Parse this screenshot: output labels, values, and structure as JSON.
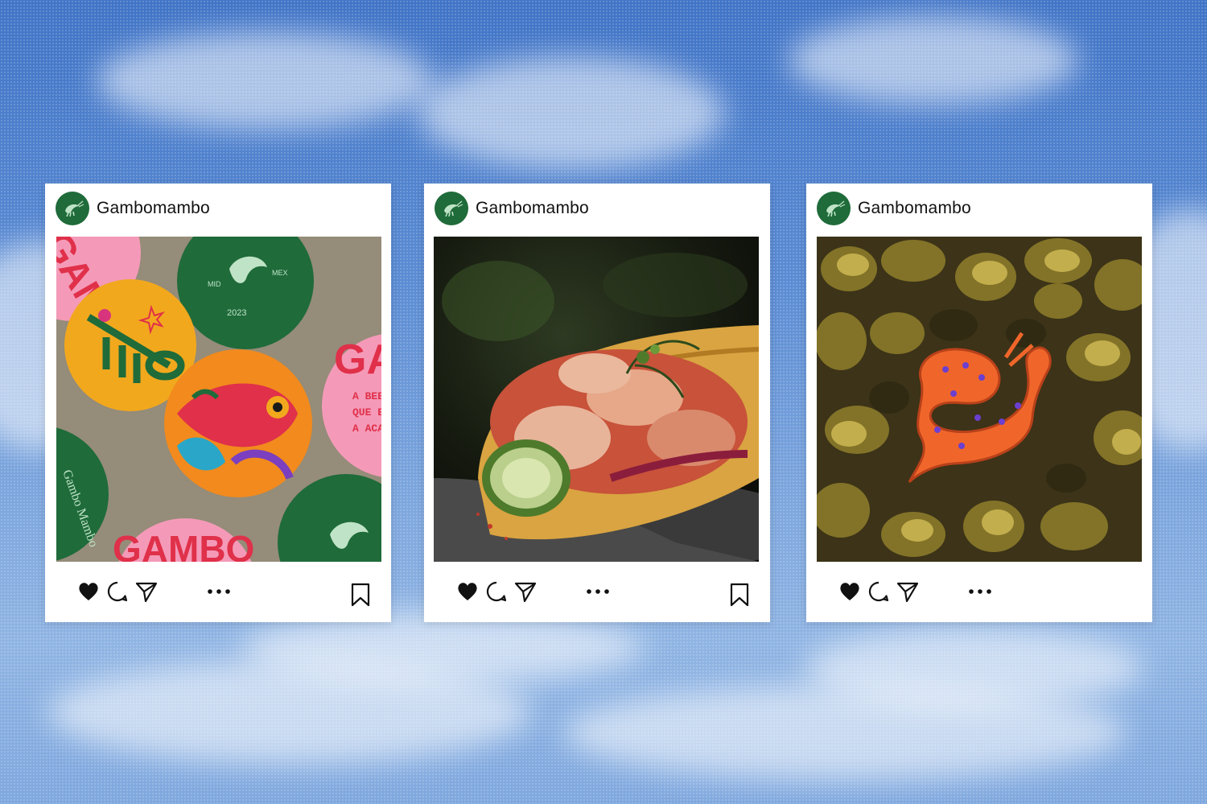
{
  "posts": [
    {
      "username": "Gambomambo",
      "photo": "coasters-flatlay",
      "coaster_texts": [
        "GAMBO",
        "GAMBO",
        "GA",
        "A BEBE",
        "QUE EI",
        "A ACAE",
        "Gambo Mambo",
        "MID",
        "MEX",
        "2023"
      ],
      "actions": [
        "like-icon",
        "comment-icon",
        "share-icon",
        "more-icon",
        "bookmark-icon"
      ]
    },
    {
      "username": "Gambomambo",
      "photo": "shrimp-taco",
      "actions": [
        "like-icon",
        "comment-icon",
        "share-icon",
        "more-icon",
        "bookmark-icon"
      ]
    },
    {
      "username": "Gambomambo",
      "photo": "shrimp-pin-on-oysters",
      "actions": [
        "like-icon",
        "comment-icon",
        "share-icon",
        "more-icon"
      ]
    }
  ],
  "colors": {
    "brand_green": "#1f6b3a",
    "sky_blue": "#5a8bd3",
    "card_bg": "#ffffff"
  }
}
